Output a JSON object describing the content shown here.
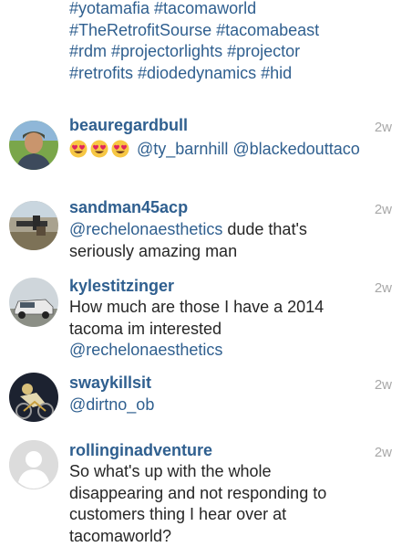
{
  "caption": {
    "lines": [
      "#yotamafia #tacomaworld",
      "#TheRetrofitSourse #tacomabeast",
      "#rdm #projectorlights #projector",
      "#retrofits #diodedynamics #hid"
    ]
  },
  "comments": [
    {
      "username": "beauregardbull",
      "time": "2w",
      "emoji_icon": "heart-eyes-emoji",
      "mentions": [
        "@ty_barnhill",
        "@blackedouttaco"
      ]
    },
    {
      "username": "sandman45acp",
      "time": "2w",
      "mention": "@rechelonaesthetics",
      "text_after_mention": " dude that's",
      "line2": "seriously amazing man"
    },
    {
      "username": "kylestitzinger",
      "time": "2w",
      "line1": "How much are those I have a 2014",
      "line2": "tacoma im interested",
      "mention": "@rechelonaesthetics"
    },
    {
      "username": "swaykillsit",
      "time": "2w",
      "mention": "@dirtno_ob"
    },
    {
      "username": "rollinginadventure",
      "time": "2w",
      "lines": [
        "So what's up with the whole",
        "disappearing and not responding to",
        "customers thing I hear over at",
        "tacomaworld?"
      ],
      "avatar_icon": "default-user-icon"
    }
  ]
}
